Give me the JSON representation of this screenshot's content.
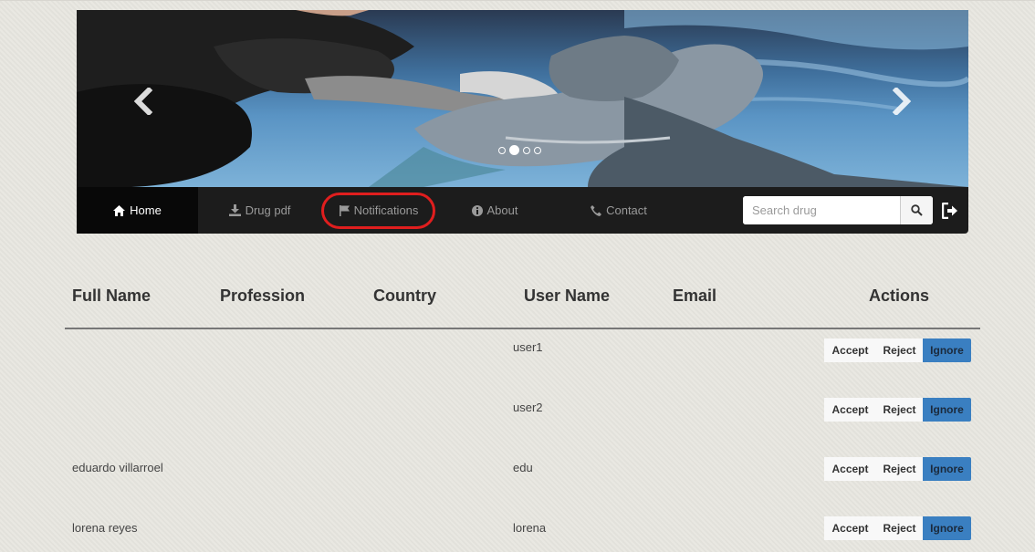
{
  "carousel": {
    "prev_icon": "chevron-left-icon",
    "next_icon": "chevron-right-icon",
    "indicators": [
      false,
      true,
      false,
      false
    ]
  },
  "navbar": {
    "items": [
      {
        "label": "Home",
        "icon": "home-icon",
        "active": true
      },
      {
        "label": "Drug pdf",
        "icon": "download-icon",
        "active": false
      },
      {
        "label": "Notifications",
        "icon": "flag-icon",
        "active": false
      },
      {
        "label": "About",
        "icon": "info-icon",
        "active": false
      },
      {
        "label": "Contact",
        "icon": "phone-icon",
        "active": false
      }
    ],
    "search_placeholder": "Search drug",
    "search_icon": "search-icon",
    "logout_icon": "logout-icon",
    "highlight_color": "#e01e1e"
  },
  "table": {
    "headers": {
      "full_name": "Full Name",
      "profession": "Profession",
      "country": "Country",
      "user_name": "User Name",
      "email": "Email",
      "actions": "Actions"
    },
    "rows": [
      {
        "full_name": "",
        "profession": "",
        "country": "",
        "user_name": "user1",
        "email": ""
      },
      {
        "full_name": "",
        "profession": "",
        "country": "",
        "user_name": "user2",
        "email": ""
      },
      {
        "full_name": "eduardo villarroel",
        "profession": "",
        "country": "",
        "user_name": "edu",
        "email": ""
      },
      {
        "full_name": "lorena reyes",
        "profession": "",
        "country": "",
        "user_name": "lorena",
        "email": ""
      }
    ],
    "action_labels": {
      "accept": "Accept",
      "reject": "Reject",
      "ignore": "Ignore"
    },
    "ignore_color": "#3a7fc1"
  }
}
